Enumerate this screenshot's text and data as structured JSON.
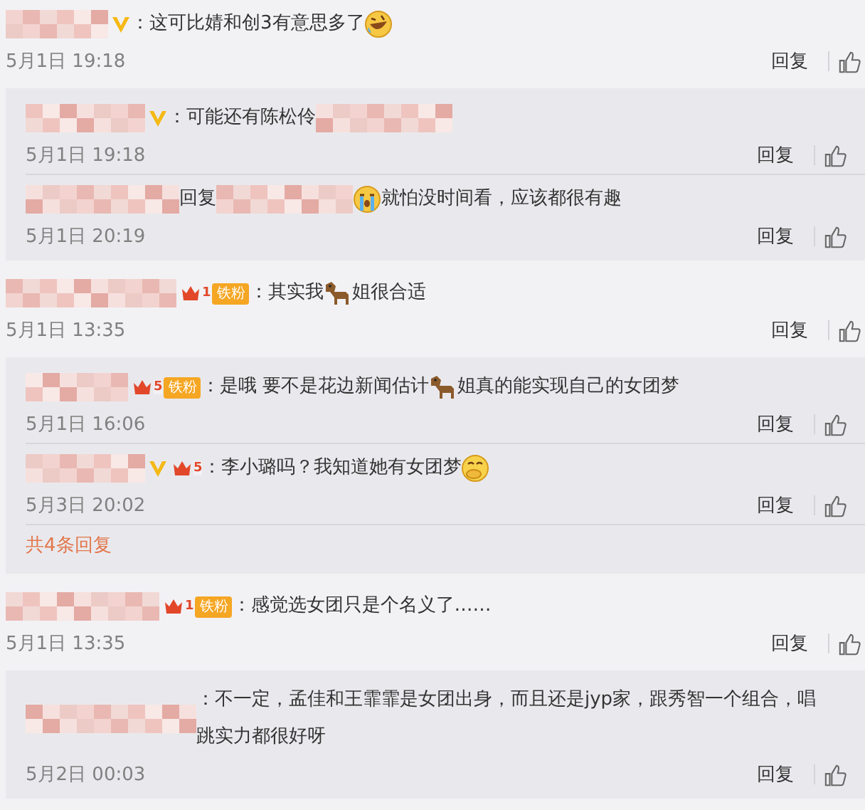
{
  "comments": [
    {
      "badges": [
        {
          "kind": "verified"
        }
      ],
      "parts": [
        {
          "kind": "text",
          "text": "：这可比婧和创3有意思多了"
        },
        {
          "kind": "laugh_cry"
        }
      ],
      "date": "5月1日 19:18",
      "reply_button": "回复",
      "replies": [
        {
          "badges": [
            {
              "kind": "verified"
            }
          ],
          "parts": [
            {
              "kind": "text",
              "text": "：可能还有陈松伶"
            },
            {
              "kind": "blur"
            }
          ],
          "date": "5月1日 19:18",
          "reply_button": "回复"
        },
        {
          "parts": [
            {
              "kind": "text",
              "text": "回复"
            },
            {
              "kind": "blur"
            },
            {
              "kind": "cry"
            },
            {
              "kind": "text",
              "text": "就怕没时间看，应该都很有趣"
            }
          ],
          "date": "5月1日 20:19",
          "reply_button": "回复"
        }
      ]
    },
    {
      "badges": [
        {
          "kind": "fan",
          "rank": "1",
          "label": "铁粉"
        }
      ],
      "parts": [
        {
          "kind": "text",
          "text": "：其实我"
        },
        {
          "kind": "dog"
        },
        {
          "kind": "text",
          "text": "姐很合适"
        }
      ],
      "date": "5月1日 13:35",
      "reply_button": "回复",
      "more_link": "共4条回复",
      "replies": [
        {
          "badges": [
            {
              "kind": "fan",
              "rank": "5",
              "label": "铁粉"
            }
          ],
          "parts": [
            {
              "kind": "text",
              "text": "：是哦 要不是花边新闻估计"
            },
            {
              "kind": "dog"
            },
            {
              "kind": "text",
              "text": "姐真的能实现自己的女团梦"
            }
          ],
          "date": "5月1日 16:06",
          "reply_button": "回复"
        },
        {
          "badges": [
            {
              "kind": "verified"
            },
            {
              "kind": "fan",
              "rank": "5"
            }
          ],
          "parts": [
            {
              "kind": "text",
              "text": "：李小璐吗？我知道她有女团梦"
            },
            {
              "kind": "shy"
            }
          ],
          "date": "5月3日 20:02",
          "reply_button": "回复"
        }
      ]
    },
    {
      "badges": [
        {
          "kind": "fan",
          "rank": "1",
          "label": "铁粉"
        }
      ],
      "parts": [
        {
          "kind": "text",
          "text": "：感觉选女团只是个名义了……"
        }
      ],
      "date": "5月1日 13:35",
      "reply_button": "回复",
      "replies": [
        {
          "parts": [
            {
              "kind": "text",
              "text": "：不一定，孟佳和王霏霏是女团出身，而且还是jyp家，跟秀智一个组合，唱跳实力都很好呀"
            }
          ],
          "date": "5月2日 00:03",
          "reply_button": "回复"
        }
      ]
    }
  ]
}
